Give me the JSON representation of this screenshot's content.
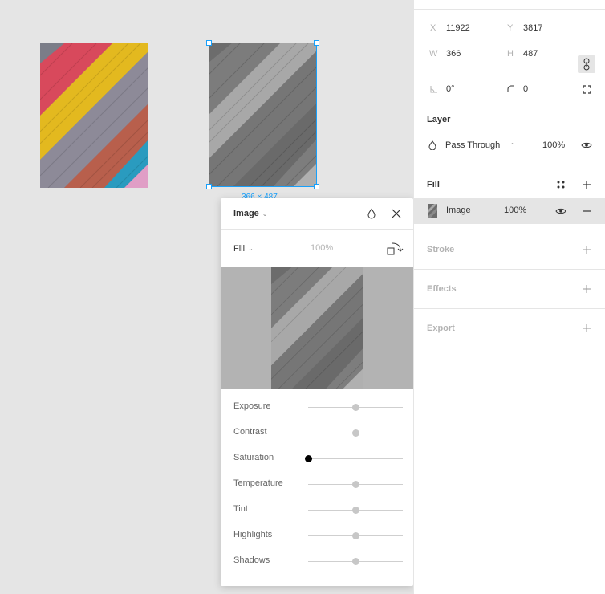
{
  "canvas": {
    "dimension_label": "366 × 487"
  },
  "image_popover": {
    "type_label": "Image",
    "fill_mode_label": "Fill",
    "opacity": "100%",
    "adjustments": [
      {
        "label": "Exposure",
        "value": 0
      },
      {
        "label": "Contrast",
        "value": 0
      },
      {
        "label": "Saturation",
        "value": -100
      },
      {
        "label": "Temperature",
        "value": 0
      },
      {
        "label": "Tint",
        "value": 0
      },
      {
        "label": "Highlights",
        "value": 0
      },
      {
        "label": "Shadows",
        "value": 0
      }
    ]
  },
  "properties": {
    "x_label": "X",
    "x_value": "11922",
    "y_label": "Y",
    "y_value": "3817",
    "w_label": "W",
    "w_value": "366",
    "h_label": "H",
    "h_value": "487",
    "rotation_value": "0°",
    "radius_value": "0"
  },
  "layer": {
    "title": "Layer",
    "blend_mode": "Pass Through",
    "opacity": "100%"
  },
  "fill": {
    "title": "Fill",
    "item_type": "Image",
    "item_opacity": "100%"
  },
  "stroke": {
    "title": "Stroke"
  },
  "effects": {
    "title": "Effects"
  },
  "export": {
    "title": "Export"
  },
  "colors": {
    "selection": "#18a0fb",
    "panel_bg": "#ffffff",
    "canvas_bg": "#e5e5e5",
    "muted_text": "#b3b3b3"
  }
}
